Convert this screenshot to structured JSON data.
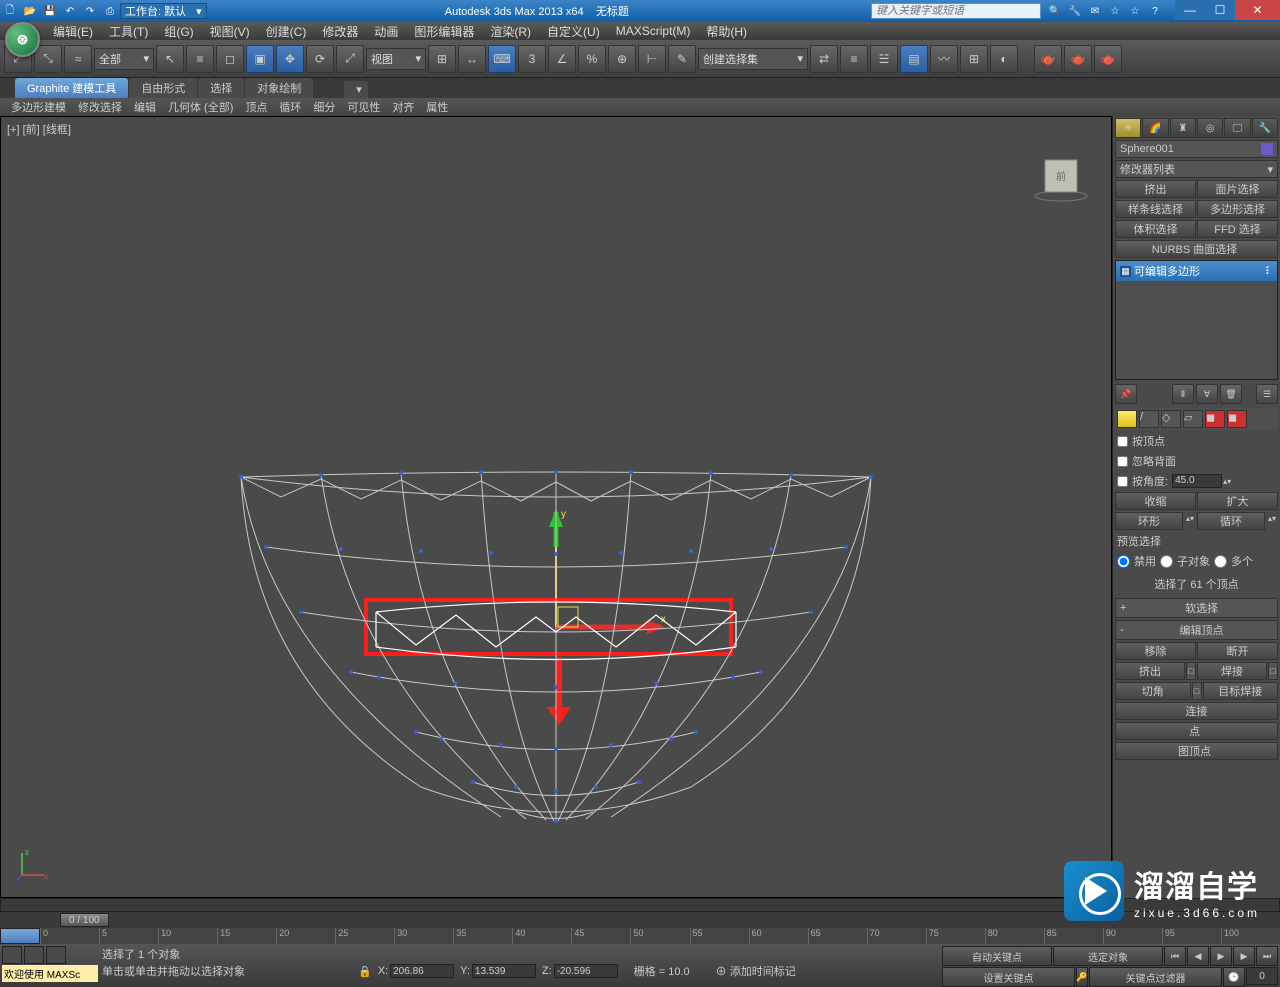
{
  "title": {
    "app": "Autodesk 3ds Max  2013 x64",
    "doc": "无标题",
    "workspace_label": "工作台: 默认",
    "search_placeholder": "键入关键字或短语"
  },
  "menu": [
    "编辑(E)",
    "工具(T)",
    "组(G)",
    "视图(V)",
    "创建(C)",
    "修改器",
    "动画",
    "图形编辑器",
    "渲染(R)",
    "自定义(U)",
    "MAXScript(M)",
    "帮助(H)"
  ],
  "toolbar": {
    "filter": "全部",
    "ref_combo": "视图",
    "named_sel": "创建选择集"
  },
  "ribbon": {
    "tabs": [
      "Graphite 建模工具",
      "自由形式",
      "选择",
      "对象绘制"
    ],
    "sub": [
      "多边形建模",
      "修改选择",
      "编辑",
      "几何体 (全部)",
      "顶点",
      "循环",
      "细分",
      "可见性",
      "对齐",
      "属性"
    ]
  },
  "viewport": {
    "label": "[+] [前] [线框]",
    "cube_face": "前"
  },
  "panel": {
    "obj_name": "Sphere001",
    "mod_list_label": "修改器列表",
    "mod_buttons": [
      [
        "挤出",
        "面片选择"
      ],
      [
        "样条线选择",
        "多边形选择"
      ],
      [
        "体积选择",
        "FFD 选择"
      ]
    ],
    "nurbs": "NURBS 曲面选择",
    "stack_item": "可编辑多边形",
    "by_vertex": "按顶点",
    "ignore_back": "忽略背面",
    "by_angle": "按角度:",
    "angle_val": "45.0",
    "shrink": "收缩",
    "grow": "扩大",
    "ring": "环形",
    "loop": "循环",
    "preview_label": "预览选择",
    "preview": [
      "禁用",
      "子对象",
      "多个"
    ],
    "sel_count": "选择了 61 个顶点",
    "soft_sel": "软选择",
    "edit_vert": "编辑顶点",
    "edit_btns": [
      [
        "移除",
        "断开"
      ],
      [
        "挤出",
        "焊接"
      ],
      [
        "切角",
        "目标焊接"
      ]
    ],
    "connect": "连接",
    "extra1": "点",
    "extra2": "图顶点"
  },
  "timeline": {
    "slider": "0 / 100",
    "ticks": [
      "0",
      "5",
      "10",
      "15",
      "20",
      "25",
      "30",
      "35",
      "40",
      "45",
      "50",
      "55",
      "60",
      "65",
      "70",
      "75",
      "80",
      "85",
      "90",
      "95",
      "100"
    ]
  },
  "status": {
    "welcome": "欢迎使用 MAXSc",
    "sel": "选择了 1 个对象",
    "hint": "单击或单击并拖动以选择对象",
    "x": "206.86",
    "y": "13.539",
    "z": "-20.596",
    "grid": "栅格 = 10.0",
    "add_time": "添加时间标记",
    "autokey": "自动关键点",
    "selonly": "选定对象",
    "setkey": "设置关键点",
    "keyfilter": "关键点过滤器",
    "frame": "0"
  },
  "watermark": {
    "big": "溜溜自学",
    "small": "zixue.3d66.com"
  }
}
